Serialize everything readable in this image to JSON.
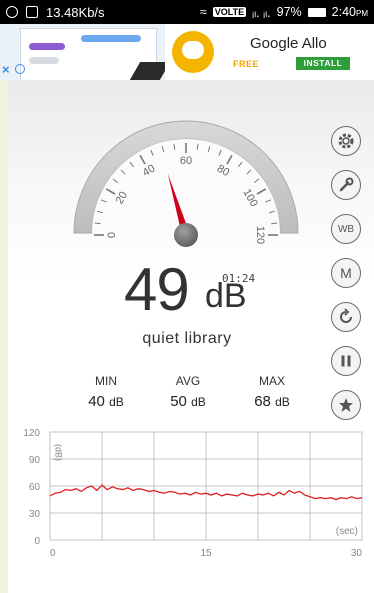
{
  "status_bar": {
    "speed": "13.48Kb/s",
    "network_badge": "VOLTE",
    "signal_text": "ᵢₗ. ᵢₗ.",
    "battery": "97%",
    "time": "2:40",
    "time_suffix": "PM"
  },
  "ad": {
    "title": "Google Allo",
    "free_label": "FREE",
    "install_label": "INSTALL",
    "close_label": "×",
    "colors": {
      "logo": "#f5b400",
      "install": "#2e9d3a",
      "free": "#f0a400"
    }
  },
  "gauge": {
    "tick_labels": [
      "0",
      "20",
      "40",
      "60",
      "80",
      "100",
      "120"
    ],
    "min": 0,
    "max": 120,
    "needle_value": 49,
    "needle_color": "#d0021b"
  },
  "reading": {
    "value": "49",
    "unit": "dB",
    "time": "01:24",
    "description": "quiet library"
  },
  "stats": {
    "min": {
      "label": "MIN",
      "value": "40",
      "unit": "dB"
    },
    "avg": {
      "label": "AVG",
      "value": "50",
      "unit": "dB"
    },
    "max": {
      "label": "MAX",
      "value": "68",
      "unit": "dB"
    }
  },
  "side_buttons": [
    {
      "name": "settings-button",
      "icon": "gear-icon",
      "label": ""
    },
    {
      "name": "tools-button",
      "icon": "wrench-icon",
      "label": ""
    },
    {
      "name": "white-balance-button",
      "icon": "wb-icon",
      "label": "WB"
    },
    {
      "name": "mode-button",
      "icon": "m-icon",
      "label": "M"
    },
    {
      "name": "reset-button",
      "icon": "refresh-icon",
      "label": ""
    },
    {
      "name": "pause-button",
      "icon": "pause-icon",
      "label": ""
    },
    {
      "name": "favorite-button",
      "icon": "star-icon",
      "label": ""
    }
  ],
  "chart_data": {
    "type": "line",
    "x_unit": "(sec)",
    "y_unit": "(dB)",
    "xlim": [
      0,
      30
    ],
    "ylim": [
      0,
      120
    ],
    "x_ticks": [
      "0",
      "15",
      "30"
    ],
    "y_ticks": [
      "0",
      "30",
      "60",
      "90",
      "120"
    ],
    "line_color": "#e02020",
    "series": [
      {
        "x": [
          0,
          0.5,
          1,
          1.5,
          2,
          2.5,
          3,
          3.5,
          4,
          4.5,
          5,
          5.5,
          6,
          6.5,
          7,
          7.5,
          8,
          8.5,
          9,
          9.5,
          10,
          10.5,
          11,
          11.5,
          12,
          12.5,
          13,
          13.5,
          14,
          14.5,
          15,
          15.5,
          16,
          16.5,
          17,
          17.5,
          18,
          18.5,
          19,
          19.5,
          20,
          20.5,
          21,
          21.5,
          22,
          22.5,
          23,
          23.5,
          24,
          24.5,
          25,
          25.5,
          26,
          26.5,
          27,
          27.5,
          28,
          28.5,
          29,
          29.5,
          30
        ],
        "y": [
          49,
          52,
          53,
          56,
          55,
          57,
          54,
          58,
          60,
          55,
          61,
          56,
          59,
          57,
          56,
          58,
          55,
          57,
          56,
          54,
          55,
          53,
          52,
          54,
          53,
          51,
          52,
          50,
          53,
          51,
          52,
          50,
          52,
          49,
          51,
          50,
          49,
          52,
          50,
          49,
          51,
          50,
          52,
          49,
          53,
          50,
          55,
          52,
          54,
          50,
          48,
          46,
          47,
          46,
          47,
          45,
          47,
          46,
          48,
          46,
          47
        ]
      }
    ],
    "grid": true
  }
}
